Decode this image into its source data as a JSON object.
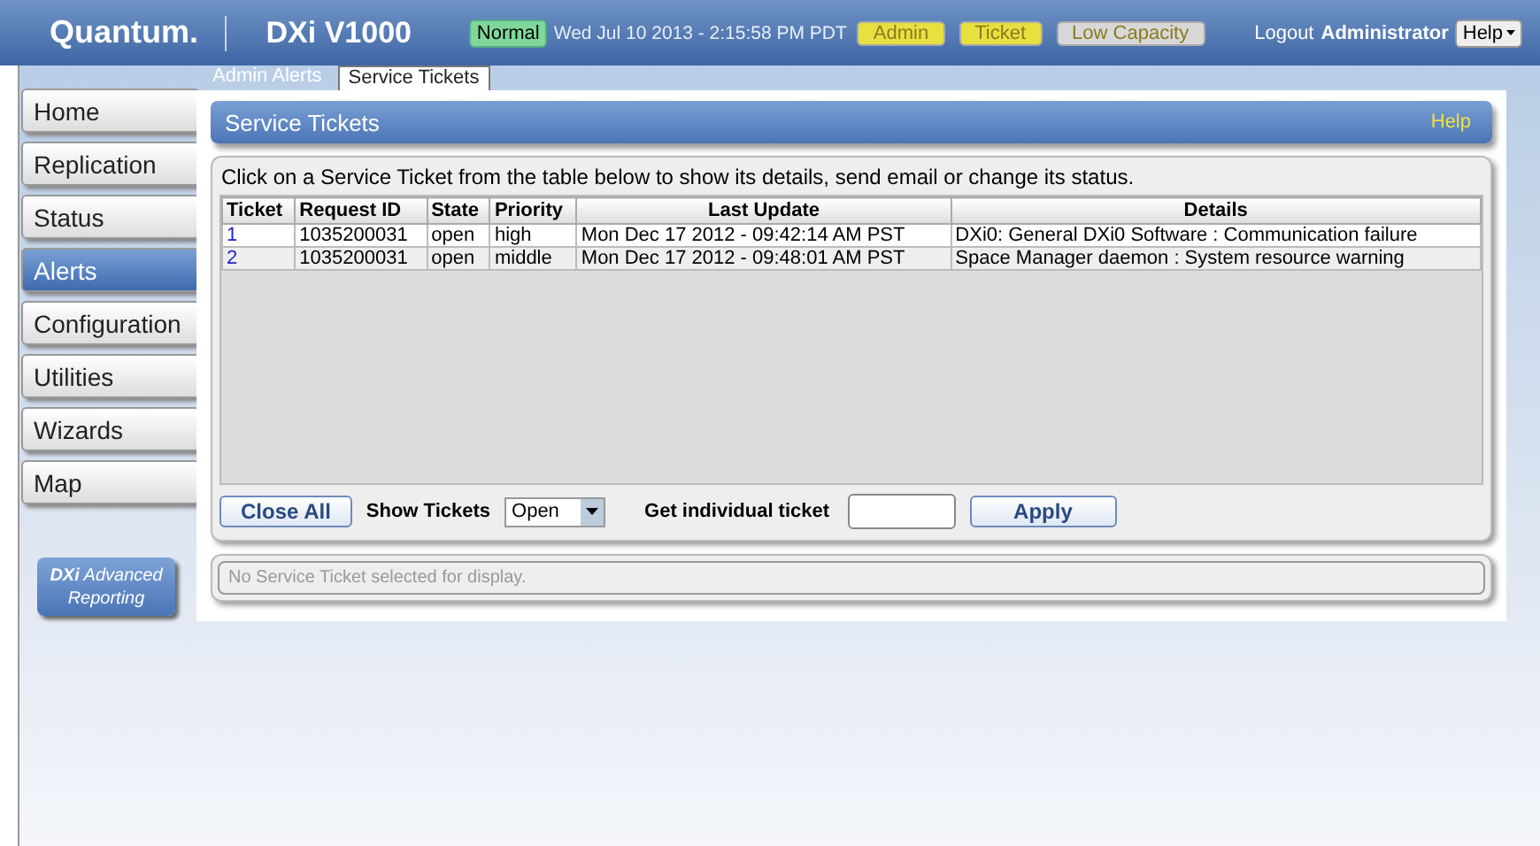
{
  "header": {
    "brand": "Quantum.",
    "product": "DXi V1000",
    "status": {
      "label": "Normal",
      "color": "#7fd89a"
    },
    "datetime": "Wed Jul 10 2013 - 2:15:58 PM PDT",
    "badges": [
      {
        "label": "Admin",
        "color": "#e8e040"
      },
      {
        "label": "Ticket",
        "color": "#e8e040"
      },
      {
        "label": "Low Capacity",
        "color": "#d8d8d8"
      }
    ],
    "logout": "Logout",
    "user": "Administrator",
    "help": "Help"
  },
  "subtabs": [
    {
      "label": "Admin Alerts",
      "selected": false
    },
    {
      "label": "Service Tickets",
      "selected": true
    }
  ],
  "sidebar": {
    "items": [
      {
        "label": "Home",
        "selected": false
      },
      {
        "label": "Replication",
        "selected": false
      },
      {
        "label": "Status",
        "selected": false
      },
      {
        "label": "Alerts",
        "selected": true
      },
      {
        "label": "Configuration",
        "selected": false
      },
      {
        "label": "Utilities",
        "selected": false
      },
      {
        "label": "Wizards",
        "selected": false
      },
      {
        "label": "Map",
        "selected": false
      }
    ],
    "reporting": {
      "line1_bold": "DXi",
      "line1": "Advanced",
      "line2": "Reporting"
    }
  },
  "panel": {
    "title": "Service Tickets",
    "help": "Help",
    "instructions": "Click on a Service Ticket from the table below to show its details, send email or change its status.",
    "table": {
      "columns": [
        "Ticket",
        "Request ID",
        "State",
        "Priority",
        "Last Update",
        "Details"
      ],
      "rows": [
        [
          "1",
          "1035200031",
          "open",
          "high",
          "Mon Dec 17 2012 - 09:42:14 AM PST",
          "DXi0: General DXi0 Software : Communication failure"
        ],
        [
          "2",
          "1035200031",
          "open",
          "middle",
          "Mon Dec 17 2012 - 09:48:01 AM PST",
          "Space Manager daemon : System resource warning"
        ]
      ]
    },
    "close_all": "Close All",
    "show_tickets_label": "Show Tickets",
    "show_tickets_value": "Open",
    "individual_label": "Get individual ticket",
    "apply": "Apply",
    "detail_message": "No Service Ticket selected for display."
  }
}
